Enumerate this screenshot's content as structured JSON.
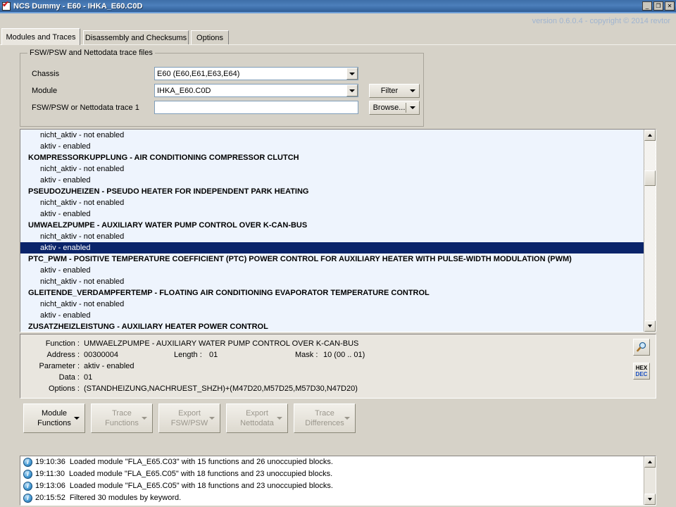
{
  "window": {
    "title": "NCS Dummy - E60 - IHKA_E60.C0D",
    "icon": "checkbox-checked-icon",
    "minimize_label": "_",
    "maximize_label": "❐",
    "close_label": "✕"
  },
  "banner": {
    "text": "version 0.6.0.4 - copyright © 2014 revtor"
  },
  "tabs": [
    {
      "label": "Modules and Traces",
      "active": true
    },
    {
      "label": "Disassembly and Checksums",
      "active": false
    },
    {
      "label": "Options",
      "active": false
    }
  ],
  "groupbox": {
    "title": "FSW/PSW and Nettodata trace files",
    "fields": [
      {
        "label": "Chassis",
        "value": "E60  (E60,E61,E63,E64)"
      },
      {
        "label": "Module",
        "value": "IHKA_E60.C0D"
      },
      {
        "label": "FSW/PSW or Nettodata trace 1",
        "value": ""
      }
    ],
    "filter_button": "Filter",
    "browse_button": "Browse..."
  },
  "function_list": [
    {
      "type": "opt",
      "text": "nicht_aktiv  -  not enabled",
      "selected": false
    },
    {
      "type": "opt",
      "text": "aktiv  -  enabled",
      "selected": false
    },
    {
      "type": "func",
      "text": "KOMPRESSORKUPPLUNG  -  AIR CONDITIONING COMPRESSOR CLUTCH",
      "selected": false
    },
    {
      "type": "opt",
      "text": "nicht_aktiv  -  not enabled",
      "selected": false
    },
    {
      "type": "opt",
      "text": "aktiv  -  enabled",
      "selected": false
    },
    {
      "type": "func",
      "text": "PSEUDOZUHEIZEN  -  PSEUDO HEATER FOR INDEPENDENT PARK HEATING",
      "selected": false
    },
    {
      "type": "opt",
      "text": "nicht_aktiv  -  not enabled",
      "selected": false
    },
    {
      "type": "opt",
      "text": "aktiv  -  enabled",
      "selected": false
    },
    {
      "type": "func",
      "text": "UMWAELZPUMPE  -  AUXILIARY WATER PUMP CONTROL OVER K-CAN-BUS",
      "selected": false
    },
    {
      "type": "opt",
      "text": "nicht_aktiv  -  not enabled",
      "selected": false
    },
    {
      "type": "opt",
      "text": "aktiv  -  enabled",
      "selected": true
    },
    {
      "type": "func",
      "text": "PTC_PWM  -  POSITIVE TEMPERATURE COEFFICIENT (PTC) POWER CONTROL FOR AUXILIARY HEATER WITH PULSE-WIDTH MODULATION (PWM)",
      "selected": false
    },
    {
      "type": "opt",
      "text": "aktiv  -  enabled",
      "selected": false
    },
    {
      "type": "opt",
      "text": "nicht_aktiv  -  not enabled",
      "selected": false
    },
    {
      "type": "func",
      "text": "GLEITENDE_VERDAMPFERTEMP  -  FLOATING AIR CONDITIONING EVAPORATOR TEMPERATURE CONTROL",
      "selected": false
    },
    {
      "type": "opt",
      "text": "nicht_aktiv  -  not enabled",
      "selected": false
    },
    {
      "type": "opt",
      "text": "aktiv  -  enabled",
      "selected": false
    },
    {
      "type": "func",
      "text": "ZUSATZHEIZLEISTUNG  -  AUXILIARY HEATER POWER CONTROL",
      "selected": false
    }
  ],
  "details": {
    "function_label": "Function :",
    "function_value": "UMWAELZPUMPE  -  AUXILIARY WATER PUMP CONTROL OVER K-CAN-BUS",
    "address_label": "Address :",
    "address_value": "00300004",
    "length_label": "Length :",
    "length_value": "01",
    "mask_label": "Mask :",
    "mask_value": "10  (00 .. 01)",
    "parameter_label": "Parameter :",
    "parameter_value": "aktiv  -  enabled",
    "data_label": "Data :",
    "data_value": "01",
    "options_label": "Options :",
    "options_value": "(STANDHEIZUNG,NACHRUEST_SHZH)+(M47D20,M57D25,M57D30,N47D20)",
    "search_icon": "magnifier-icon",
    "hex_label": "HEX",
    "dec_label": "DEC"
  },
  "toolbar": [
    {
      "line1": "Module",
      "line2": "Functions",
      "enabled": true
    },
    {
      "line1": "Trace",
      "line2": "Functions",
      "enabled": false
    },
    {
      "line1": "Export",
      "line2": "FSW/PSW",
      "enabled": false
    },
    {
      "line1": "Export",
      "line2": "Nettodata",
      "enabled": false
    },
    {
      "line1": "Trace",
      "line2": "Differences",
      "enabled": false
    }
  ],
  "log": [
    {
      "time": "19:10:36",
      "message": "Loaded module \"FLA_E65.C03\" with 15 functions and 26 unoccupied blocks."
    },
    {
      "time": "19:11:30",
      "message": "Loaded module \"FLA_E65.C05\" with 18 functions and 23 unoccupied blocks."
    },
    {
      "time": "19:13:06",
      "message": "Loaded module \"FLA_E65.C05\" with 18 functions and 23 unoccupied blocks."
    },
    {
      "time": "20:15:52",
      "message": "Filtered 30 modules by keyword."
    }
  ],
  "colors": {
    "selection": "#0a246a",
    "list_background": "#eef4fd",
    "window_background": "#d6d2c8",
    "banner_text": "#9fb4d0"
  }
}
